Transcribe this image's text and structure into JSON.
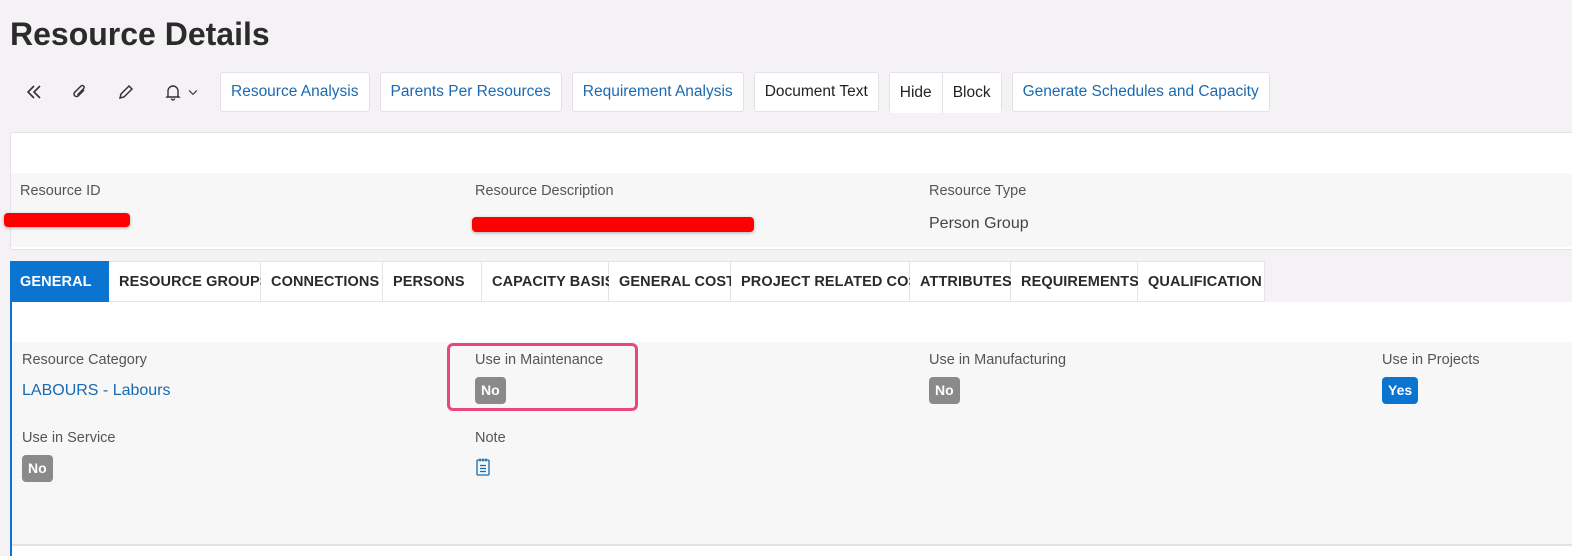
{
  "page": {
    "title": "Resource Details"
  },
  "toolbar": {
    "buttons": [
      "Resource Analysis",
      "Parents Per Resources",
      "Requirement Analysis",
      "Document Text",
      "Hide",
      "Block",
      "Generate Schedules and Capacity"
    ]
  },
  "header": {
    "resource_id": {
      "label": "Resource ID",
      "value": ""
    },
    "resource_description": {
      "label": "Resource Description",
      "value": ""
    },
    "resource_type": {
      "label": "Resource Type",
      "value": "Person Group"
    }
  },
  "tabs": [
    {
      "label": "GENERAL",
      "active": true
    },
    {
      "label": "RESOURCE GROUPS"
    },
    {
      "label": "CONNECTIONS"
    },
    {
      "label": "PERSONS"
    },
    {
      "label": "CAPACITY BASIS"
    },
    {
      "label": "GENERAL COST"
    },
    {
      "label": "PROJECT RELATED COST"
    },
    {
      "label": "ATTRIBUTES"
    },
    {
      "label": "REQUIREMENTS"
    },
    {
      "label": "QUALIFICATION"
    }
  ],
  "general": {
    "resource_category": {
      "label": "Resource Category",
      "value": "LABOURS - Labours"
    },
    "use_in_maintenance": {
      "label": "Use in Maintenance",
      "value": "No"
    },
    "use_in_manufacturing": {
      "label": "Use in Manufacturing",
      "value": "No"
    },
    "use_in_projects": {
      "label": "Use in Projects",
      "value": "Yes"
    },
    "use_in_service": {
      "label": "Use in Service",
      "value": "No"
    },
    "note": {
      "label": "Note"
    }
  },
  "colors": {
    "accent": "#0b74d1",
    "link": "#1a6ab0",
    "badge_no": "#8a8a8a",
    "highlight": "#e8467c",
    "redaction": "#ff0000"
  }
}
